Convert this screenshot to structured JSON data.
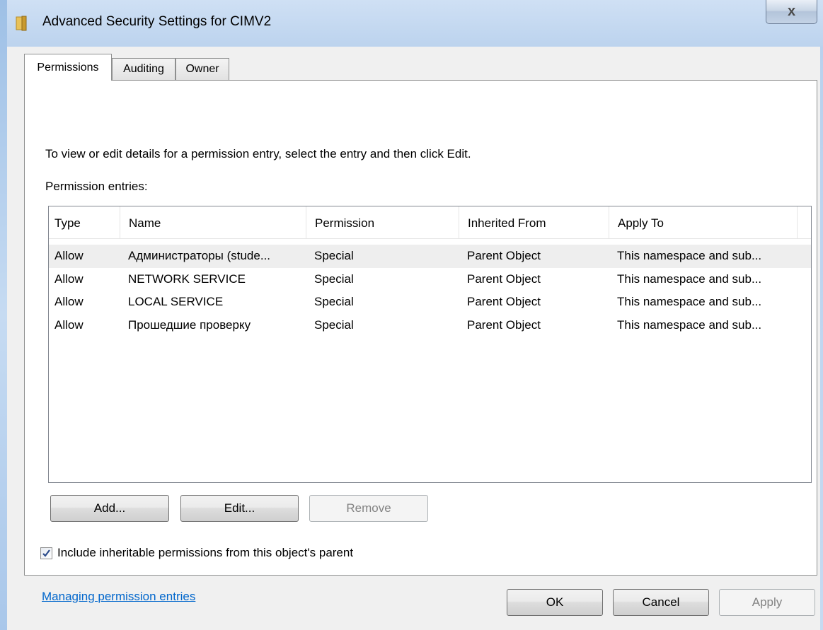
{
  "window": {
    "title": "Advanced Security Settings for CIMV2",
    "close_label": "x"
  },
  "tabs": [
    {
      "label": "Permissions",
      "active": true
    },
    {
      "label": "Auditing",
      "active": false
    },
    {
      "label": "Owner",
      "active": false
    }
  ],
  "permissions": {
    "instruction": "To view or edit details for a permission entry, select the entry and then click Edit.",
    "entries_label": "Permission entries:",
    "columns": [
      "Type",
      "Name",
      "Permission",
      "Inherited From",
      "Apply To"
    ],
    "rows": [
      {
        "type": "Allow",
        "name": "Администраторы (stude...",
        "permission": "Special",
        "inherited_from": "Parent Object",
        "apply_to": "This namespace and sub...",
        "selected": true
      },
      {
        "type": "Allow",
        "name": "NETWORK SERVICE",
        "permission": "Special",
        "inherited_from": "Parent Object",
        "apply_to": "This namespace and sub...",
        "selected": false
      },
      {
        "type": "Allow",
        "name": "LOCAL SERVICE",
        "permission": "Special",
        "inherited_from": "Parent Object",
        "apply_to": "This namespace and sub...",
        "selected": false
      },
      {
        "type": "Allow",
        "name": "Прошедшие проверку",
        "permission": "Special",
        "inherited_from": "Parent Object",
        "apply_to": "This namespace and sub...",
        "selected": false
      }
    ],
    "add_label": "Add...",
    "edit_label": "Edit...",
    "remove_label": "Remove",
    "include_inheritable_label": "Include inheritable permissions from this object's parent",
    "include_inheritable_checked": true,
    "help_link": "Managing permission entries"
  },
  "footer": {
    "ok_label": "OK",
    "cancel_label": "Cancel",
    "apply_label": "Apply"
  },
  "colors": {
    "title_bar": "#bcd3ee",
    "client_bg": "#f0f0f0",
    "selected_row": "#eeeeee",
    "link": "#0066cc"
  }
}
